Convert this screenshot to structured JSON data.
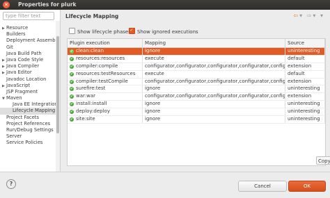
{
  "window": {
    "title": "Properties for plurk",
    "close_glyph": "✕"
  },
  "filter": {
    "placeholder": "type filter text"
  },
  "tree": [
    {
      "label": "Resource",
      "arrow": "▶",
      "indent": 1
    },
    {
      "label": "Builders",
      "arrow": "",
      "indent": 1
    },
    {
      "label": "Deployment Assembly",
      "arrow": "",
      "indent": 1
    },
    {
      "label": "Git",
      "arrow": "",
      "indent": 1
    },
    {
      "label": "Java Build Path",
      "arrow": "",
      "indent": 1
    },
    {
      "label": "Java Code Style",
      "arrow": "▶",
      "indent": 1
    },
    {
      "label": "Java Compiler",
      "arrow": "▶",
      "indent": 1
    },
    {
      "label": "Java Editor",
      "arrow": "▶",
      "indent": 1
    },
    {
      "label": "Javadoc Location",
      "arrow": "",
      "indent": 1
    },
    {
      "label": "JavaScript",
      "arrow": "▶",
      "indent": 1
    },
    {
      "label": "JSP Fragment",
      "arrow": "",
      "indent": 1
    },
    {
      "label": "Maven",
      "arrow": "▼",
      "indent": 1
    },
    {
      "label": "Java EE Integration",
      "arrow": "",
      "indent": 2
    },
    {
      "label": "Lifecycle Mapping",
      "arrow": "",
      "indent": 2,
      "selected": true
    },
    {
      "label": "Project Facets",
      "arrow": "",
      "indent": 1
    },
    {
      "label": "Project References",
      "arrow": "",
      "indent": 1
    },
    {
      "label": "Run/Debug Settings",
      "arrow": "",
      "indent": 1
    },
    {
      "label": "Server",
      "arrow": "",
      "indent": 1
    },
    {
      "label": "Service Policies",
      "arrow": "",
      "indent": 1
    }
  ],
  "page": {
    "title": "Lifecycle Mapping",
    "nav": {
      "back": "⇦",
      "back_menu": "▾",
      "forward": "⇨",
      "forward_menu": "▾",
      "menu": "▾"
    }
  },
  "options": {
    "show_phases": {
      "label": "Show lifecycle phases",
      "checked": false
    },
    "show_ignored": {
      "label": "Show ignored executions",
      "checked": true
    }
  },
  "table": {
    "columns": [
      "Plugin execution",
      "Mapping",
      "Source"
    ],
    "rows": [
      {
        "execution": "clean:clean",
        "mapping": "ignore",
        "source": "uninteresting",
        "selected": true
      },
      {
        "execution": "resources:resources",
        "mapping": "execute",
        "source": "default"
      },
      {
        "execution": "compiler:compile",
        "mapping": "configurator,configurator,configurator,configurator,configura",
        "source": "extension"
      },
      {
        "execution": "resources:testResources",
        "mapping": "execute",
        "source": "default"
      },
      {
        "execution": "compiler:testCompile",
        "mapping": "configurator,configurator,configurator,configurator,configura",
        "source": "extension"
      },
      {
        "execution": "surefire:test",
        "mapping": "ignore",
        "source": "uninteresting"
      },
      {
        "execution": "war:war",
        "mapping": "configurator,configurator,configurator,configurator,configura",
        "source": "extension"
      },
      {
        "execution": "install:install",
        "mapping": "ignore",
        "source": "uninteresting"
      },
      {
        "execution": "deploy:deploy",
        "mapping": "ignore",
        "source": "uninteresting"
      },
      {
        "execution": "site:site",
        "mapping": "ignore",
        "source": "uninteresting"
      }
    ],
    "row_icon": "✔"
  },
  "copy_button": "Copy",
  "buttons": {
    "help": "?",
    "cancel": "Cancel",
    "ok": "OK"
  },
  "colors": {
    "accent": "#e45a23",
    "ok_icon": "#4aa83a"
  }
}
